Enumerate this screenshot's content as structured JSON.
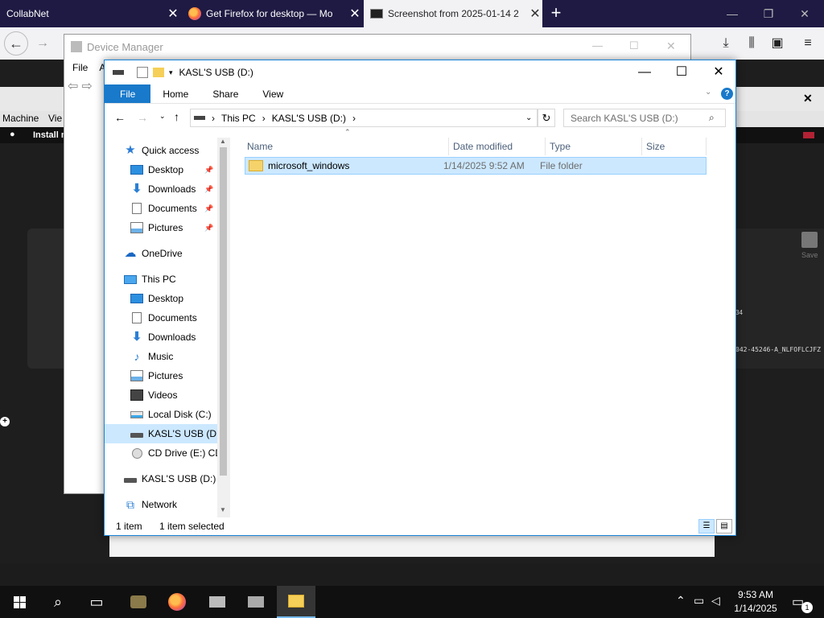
{
  "browser": {
    "tabs": [
      {
        "title": "CollabNet",
        "active": false
      },
      {
        "title": "Get Firefox for desktop — Mo",
        "active": false
      },
      {
        "title": "Screenshot from 2025-01-14 2",
        "active": true
      }
    ],
    "new_tab_label": "+",
    "back_glyph": "←",
    "forward_glyph": "→"
  },
  "vm_window": {
    "menu_items": [
      "Machine",
      "Vie"
    ],
    "mac_menu_item": "Install m",
    "log_text": "042-45246-A_NLFOFLCJFZ",
    "log_text_2": "34",
    "save_label": "Save"
  },
  "device_manager": {
    "title": "Device Manager",
    "menu": [
      "File",
      "A"
    ]
  },
  "explorer": {
    "title": "KASL'S USB (D:)",
    "ribbon_tabs": [
      "File",
      "Home",
      "Share",
      "View"
    ],
    "breadcrumb": [
      "This PC",
      "KASL'S USB (D:)"
    ],
    "search_placeholder": "Search KASL'S USB (D:)",
    "nav_items": [
      {
        "label": "Quick access",
        "icon": "star-icon",
        "indent": 1,
        "pinned": false
      },
      {
        "label": "Desktop",
        "icon": "desktop-icon",
        "indent": 2,
        "pinned": true
      },
      {
        "label": "Downloads",
        "icon": "download-icon",
        "indent": 2,
        "pinned": true
      },
      {
        "label": "Documents",
        "icon": "documents-icon",
        "indent": 2,
        "pinned": true
      },
      {
        "label": "Pictures",
        "icon": "pictures-icon",
        "indent": 2,
        "pinned": true
      },
      {
        "label": "OneDrive",
        "icon": "cloud-icon",
        "indent": 1,
        "pinned": false
      },
      {
        "label": "This PC",
        "icon": "computer-icon",
        "indent": 1,
        "pinned": false
      },
      {
        "label": "Desktop",
        "icon": "desktop-icon",
        "indent": 2,
        "pinned": false
      },
      {
        "label": "Documents",
        "icon": "documents-icon",
        "indent": 2,
        "pinned": false
      },
      {
        "label": "Downloads",
        "icon": "download-icon",
        "indent": 2,
        "pinned": false
      },
      {
        "label": "Music",
        "icon": "music-icon",
        "indent": 2,
        "pinned": false
      },
      {
        "label": "Pictures",
        "icon": "pictures-icon",
        "indent": 2,
        "pinned": false
      },
      {
        "label": "Videos",
        "icon": "videos-icon",
        "indent": 2,
        "pinned": false
      },
      {
        "label": "Local Disk (C:)",
        "icon": "disk-icon",
        "indent": 2,
        "pinned": false
      },
      {
        "label": "KASL'S USB (D:)",
        "icon": "usb-drive-icon",
        "indent": 2,
        "pinned": false,
        "selected": true
      },
      {
        "label": "CD Drive (E:) CD",
        "icon": "cd-drive-icon",
        "indent": 2,
        "pinned": false
      },
      {
        "label": "KASL'S USB (D:)",
        "icon": "usb-drive-icon",
        "indent": 1,
        "pinned": false
      },
      {
        "label": "Network",
        "icon": "network-icon",
        "indent": 1,
        "pinned": false
      }
    ],
    "columns": [
      "Name",
      "Date modified",
      "Type",
      "Size"
    ],
    "files": [
      {
        "name": "microsoft_windows",
        "date_modified": "1/14/2025 9:52 AM",
        "type": "File folder",
        "size": "",
        "selected": true
      }
    ],
    "status_item_count": "1 item",
    "status_selected": "1 item selected"
  },
  "taskbar": {
    "time": "9:53 AM",
    "date": "1/14/2025",
    "notification_count": "1"
  },
  "colors": {
    "accent": "#1979ca",
    "selection": "#cce8ff",
    "tabbar": "#1e1a43",
    "taskbar": "#101010"
  }
}
